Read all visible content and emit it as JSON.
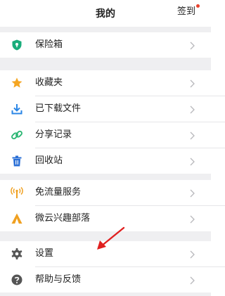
{
  "header": {
    "title": "我的",
    "signin_label": "签到"
  },
  "section1": [
    {
      "label": "保险箱",
      "icon": "shield-icon"
    }
  ],
  "section2": [
    {
      "label": "收藏夹",
      "icon": "star-icon"
    },
    {
      "label": "已下载文件",
      "icon": "download-icon"
    },
    {
      "label": "分享记录",
      "icon": "link-icon"
    },
    {
      "label": "回收站",
      "icon": "trash-icon"
    }
  ],
  "section3": [
    {
      "label": "免流量服务",
      "icon": "signal-icon"
    },
    {
      "label": "微云兴趣部落",
      "icon": "tent-icon"
    }
  ],
  "section4": [
    {
      "label": "设置",
      "icon": "gear-icon"
    },
    {
      "label": "帮助与反馈",
      "icon": "help-icon"
    }
  ],
  "colors": {
    "shield": "#1aad7b",
    "star": "#f5a623",
    "download": "#2a86e6",
    "link": "#2bb673",
    "trash": "#2a6fd6",
    "signal": "#f0a020",
    "tent": "#f0a020",
    "gear": "#555555",
    "help": "#555555",
    "annotation_arrow": "#e02020",
    "badge_dot": "#e8422e"
  }
}
